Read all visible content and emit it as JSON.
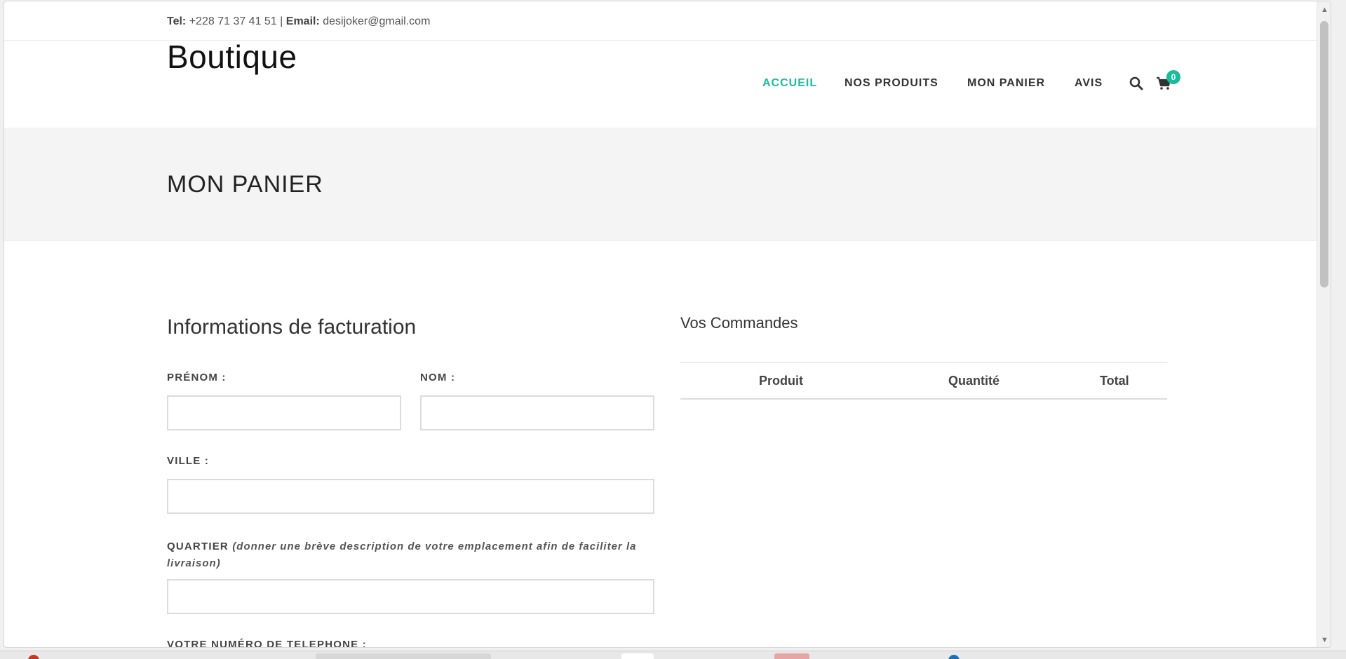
{
  "topbar": {
    "tel_label": "Tel:",
    "tel_value": " +228 71 37 41 51 | ",
    "email_label": "Email:",
    "email_value": " desijoker@gmail.com"
  },
  "header": {
    "logo": "Boutique",
    "nav": [
      {
        "label": "ACCUEIL",
        "active": true
      },
      {
        "label": "NOS PRODUITS",
        "active": false
      },
      {
        "label": "MON PANIER",
        "active": false
      },
      {
        "label": "AVIS",
        "active": false
      }
    ],
    "search_icon": "search-icon",
    "cart_icon": "cart-icon",
    "cart_count": "0"
  },
  "page_title": "MON PANIER",
  "billing": {
    "title": "Informations de facturation",
    "prenom_label": "PRÉNOM :",
    "nom_label": "NOM :",
    "ville_label": "VILLE :",
    "quartier_label": "QUARTIER",
    "quartier_hint": "(donner une brève description de votre emplacement afin de faciliter la livraison)",
    "telephone_label": "VOTRE NUMÉRO DE TELEPHONE :",
    "prenom_value": "",
    "nom_value": "",
    "ville_value": "",
    "quartier_value": ""
  },
  "orders": {
    "title": "Vos Commandes",
    "columns": [
      "Produit",
      "Quantité",
      "Total"
    ]
  },
  "colors": {
    "accent": "#1abc9c",
    "title_band": "#f4f4f4"
  }
}
